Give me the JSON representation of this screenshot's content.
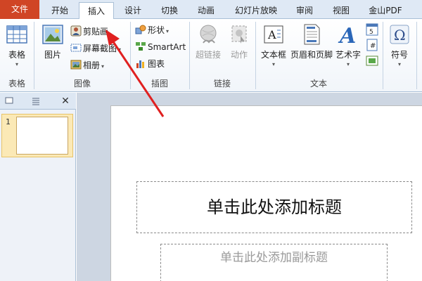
{
  "tabs": [
    {
      "label": "文件",
      "kind": "file"
    },
    {
      "label": "开始"
    },
    {
      "label": "插入",
      "active": true
    },
    {
      "label": "设计"
    },
    {
      "label": "切换"
    },
    {
      "label": "动画"
    },
    {
      "label": "幻灯片放映"
    },
    {
      "label": "审阅"
    },
    {
      "label": "视图"
    },
    {
      "label": "金山PDF"
    }
  ],
  "ribbon": {
    "groups": {
      "table": "表格",
      "image": "图像",
      "illustration": "插图",
      "link": "链接",
      "text": "文本"
    },
    "table_btn": "表格",
    "picture_btn": "图片",
    "clipart_btn": "剪贴画",
    "screenshot_btn": "屏幕截图",
    "album_btn": "相册",
    "shape_btn": "形状",
    "smartart_btn": "SmartArt",
    "chart_btn": "图表",
    "hyperlink_btn": "超链接",
    "action_btn": "动作",
    "textbox_btn": "文本框",
    "headerfooter_btn": "页眉和页脚",
    "wordart_btn": "艺术字",
    "symbol_btn": "符号",
    "dropdown_glyph": "▾",
    "omega_glyph": "Ω",
    "textbox_glyph": "A",
    "wordart_glyph": "A"
  },
  "panel": {
    "close_glyph": "✕",
    "slide_number": "1"
  },
  "slide": {
    "title_placeholder": "单击此处添加标题",
    "subtitle_placeholder": "单击此处添加副标题"
  },
  "colors": {
    "file_tab": "#d04525",
    "annotation_arrow": "#e02020"
  }
}
